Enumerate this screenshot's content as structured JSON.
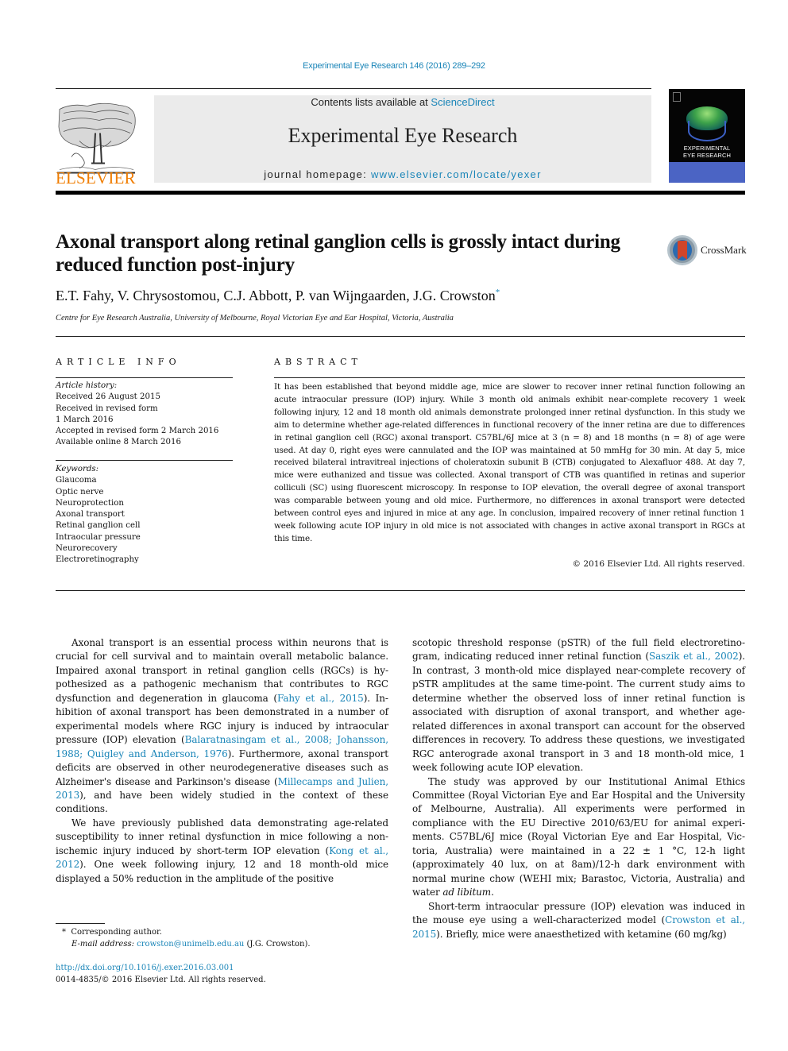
{
  "header": {
    "citation": "Experimental Eye Research 146 (2016) 289–292",
    "contents_prefix": "Contents lists available at ",
    "contents_link": "ScienceDirect",
    "journal_name": "Experimental Eye Research",
    "homepage_prefix": "journal homepage: ",
    "homepage_link": "www.elsevier.com/locate/yexer",
    "publisher_logo_text": "ELSEVIER",
    "cover_title_line1": "EXPERIMENTAL",
    "cover_title_line2": "EYE RESEARCH",
    "colors": {
      "link": "#1a85b8",
      "elsevier_orange": "#f07d00",
      "banner_bg": "#ebebeb"
    }
  },
  "article": {
    "title": "Axonal transport along retinal ganglion cells is grossly intact during reduced function post-injury",
    "crossmark_label": "CrossMark",
    "authors": "E.T. Fahy, V. Chrysostomou, C.J. Abbott, P. van Wijngaarden, J.G. Crowston",
    "author_mark": "*",
    "affiliation": "Centre for Eye Research Australia, University of Melbourne, Royal Victorian Eye and Ear Hospital, Victoria, Australia"
  },
  "article_info": {
    "heading": "ARTICLE INFO",
    "history_label": "Article history:",
    "history": [
      "Received 26 August 2015",
      "Received in revised form",
      "1 March 2016",
      "Accepted in revised form 2 March 2016",
      "Available online 8 March 2016"
    ],
    "keywords_label": "Keywords:",
    "keywords": [
      "Glaucoma",
      "Optic nerve",
      "Neuroprotection",
      "Axonal transport",
      "Retinal ganglion cell",
      "Intraocular pressure",
      "Neurorecovery",
      "Electroretinography"
    ]
  },
  "abstract": {
    "heading": "ABSTRACT",
    "text": "It has been established that beyond middle age, mice are slower to recover inner retinal function following an acute intraocular pressure (IOP) injury. While 3 month old animals exhibit near-complete recovery 1 week following injury, 12 and 18 month old animals demonstrate prolonged inner retinal dysfunction. In this study we aim to determine whether age-related differences in functional recovery of the inner retina are due to differences in retinal ganglion cell (RGC) axonal transport. C57BL/6J mice at 3 (n = 8) and 18 months (n = 8) of age were used. At day 0, right eyes were cannulated and the IOP was maintained at 50 mmHg for 30 min. At day 5, mice received bilateral intravitreal injections of cholera­toxin subunit B (CTB) conjugated to Alexafluor 488. At day 7, mice were euthanized and tissue was collected. Axonal transport of CTB was quantified in retinas and superior colliculi (SC) using fluorescent microscopy. In response to IOP elevation, the overall degree of axonal transport was comparable between young and old mice. Furthermore, no differences in axonal transport were detected between control eyes and injured in mice at any age. In conclusion, impaired recovery of inner retinal function 1 week following acute IOP injury in old mice is not associated with changes in active axonal transport in RGCs at this time.",
    "copyright": "© 2016 Elsevier Ltd. All rights reserved."
  },
  "body": {
    "left": {
      "p1_a": "Axonal transport is an essential process within neurons that is crucial for cell survival and to maintain overall metabolic balance. Impaired axonal transport in retinal ganglion cells (RGCs) is hy­pothesized as a pathogenic mechanism that contributes to RGC dysfunction and degeneration in glaucoma (",
      "p1_ref1": "Fahy et al., 2015",
      "p1_b": "). In­hibition of axonal transport has been demonstrated in a number of experimental models where RGC injury is induced by intraocular pressure (IOP) elevation (",
      "p1_ref2": "Balaratnasingam et al., 2008; Johansson, 1988; Quigley and Anderson, 1976",
      "p1_c": "). Furthermore, axonal trans­port deficits are observed in other neurodegenerative diseases such as Alzheimer's disease and Parkinson's disease (",
      "p1_ref3": "Millecamps and Julien, 2013",
      "p1_d": "), and have been widely studied in the context of these conditions.",
      "p2_a": "We have previously published data demonstrating age-related susceptibility to inner retinal dysfunction in mice following a non-ischemic injury induced by short-term IOP elevation (",
      "p2_ref1": "Kong et al., 2012",
      "p2_b": "). One week following injury, 12 and 18 month-old mice displayed a 50% reduction in the amplitude of the positive"
    },
    "right": {
      "p1_a": "scotopic threshold response (pSTR) of the full field electroretino­gram, indicating reduced inner retinal function (",
      "p1_ref1": "Saszik et al., 2002",
      "p1_b": "). In contrast, 3 month-old mice displayed near-complete recovery of pSTR amplitudes at the same time-point. The current study aims to determine whether the observed loss of inner retinal function is associated with disruption of axonal transport, and whether age-related differences in axonal transport can account for the observed differences in recovery. To address these questions, we investigated RGC anterograde axonal transport in 3 and 18 month-old mice, 1 week following acute IOP elevation.",
      "p2_a": "The study was approved by our Institutional Animal Ethics Committee (Royal Victorian Eye and Ear Hospital and the University of Melbourne, Australia). All experiments were performed in compliance with the EU Directive 2010/63/EU for animal experi­ments. C57BL/6J mice (Royal Victorian Eye and Ear Hospital, Vic­toria, Australia) were maintained in a 22 ± 1 °C, 12-h light (approximately 40 lux, on at 8am)/12-h dark environment with normal murine chow (WEHI mix; Barastoc, Victoria, Australia) and water ",
      "p2_italic": "ad libitum",
      "p2_b": ".",
      "p3_a": "Short-term intraocular pressure (IOP) elevation was induced in the mouse eye using a well-characterized model (",
      "p3_ref1": "Crowston et al., 2015",
      "p3_b": "). Briefly, mice were anaesthetized with ketamine (60 mg/kg)"
    }
  },
  "footnotes": {
    "mark": "*",
    "corresponding": "Corresponding author.",
    "email_label": "E-mail address:",
    "email": "crowston@unimelb.edu.au",
    "email_suffix": " (J.G. Crowston).",
    "doi": "http://dx.doi.org/10.1016/j.exer.2016.03.001",
    "issn_copyright": "0014-4835/© 2016 Elsevier Ltd. All rights reserved."
  }
}
